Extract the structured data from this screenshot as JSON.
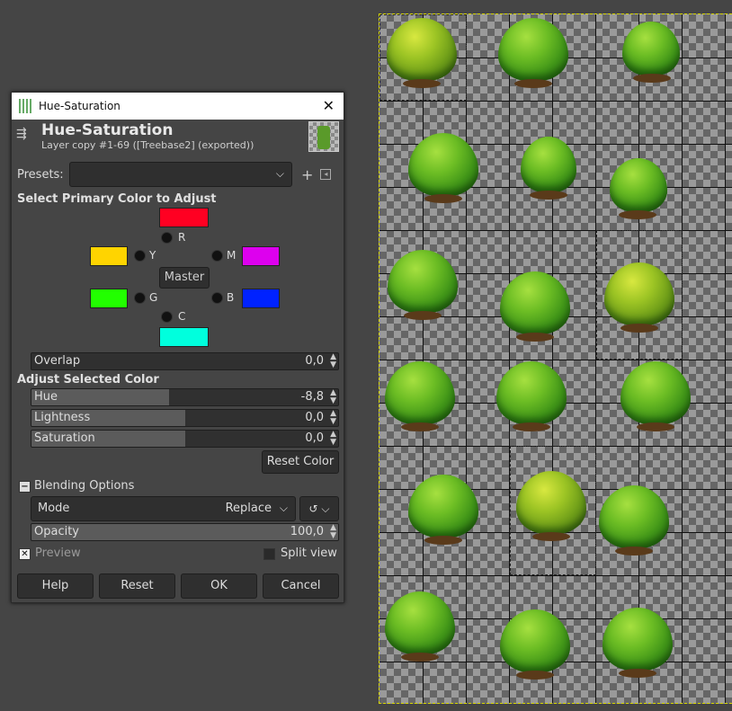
{
  "window": {
    "title": "Hue-Saturation",
    "close": "✕"
  },
  "header": {
    "title": "Hue-Saturation",
    "subtitle": "Layer copy #1-69 ([Treebase2] (exported))"
  },
  "presets": {
    "label": "Presets:",
    "value": "",
    "add": "+",
    "menu": "◂"
  },
  "primary": {
    "heading": "Select Primary Color to Adjust",
    "labels": {
      "r": "R",
      "y": "Y",
      "m": "M",
      "g": "G",
      "b": "B",
      "c": "C"
    },
    "colors": {
      "r": "#ff0022",
      "y": "#ffd400",
      "m": "#dd00ee",
      "g": "#22ff00",
      "b": "#0022ff",
      "c": "#00ffdd"
    },
    "master": "Master"
  },
  "overlap": {
    "label": "Overlap",
    "value": "0,0",
    "fill": 0
  },
  "adjust": {
    "heading": "Adjust Selected Color",
    "hue": {
      "label": "Hue",
      "value": "-8,8",
      "fill": 0.45
    },
    "lightness": {
      "label": "Lightness",
      "value": "0,0",
      "fill": 0.5
    },
    "saturation": {
      "label": "Saturation",
      "value": "0,0",
      "fill": 0.5
    },
    "reset": "Reset Color"
  },
  "blending": {
    "heading": "Blending Options",
    "mode_label": "Mode",
    "mode_value": "Replace",
    "opacity_label": "Opacity",
    "opacity_value": "100,0",
    "opacity_fill": 1.0
  },
  "preview": {
    "label": "Preview",
    "checked": true
  },
  "split": {
    "label": "Split view",
    "checked": false
  },
  "buttons": {
    "help": "Help",
    "reset": "Reset",
    "ok": "OK",
    "cancel": "Cancel"
  }
}
